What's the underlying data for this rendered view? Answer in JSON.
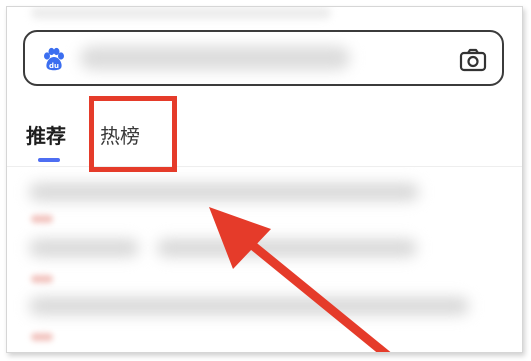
{
  "tabs": {
    "recommend": "推荐",
    "hot_list": "热榜"
  },
  "icons": {
    "app_logo": "baidu-paw-icon",
    "camera": "camera-icon"
  },
  "colors": {
    "accent": "#4e6ef2",
    "annotation": "#e53b2a"
  }
}
